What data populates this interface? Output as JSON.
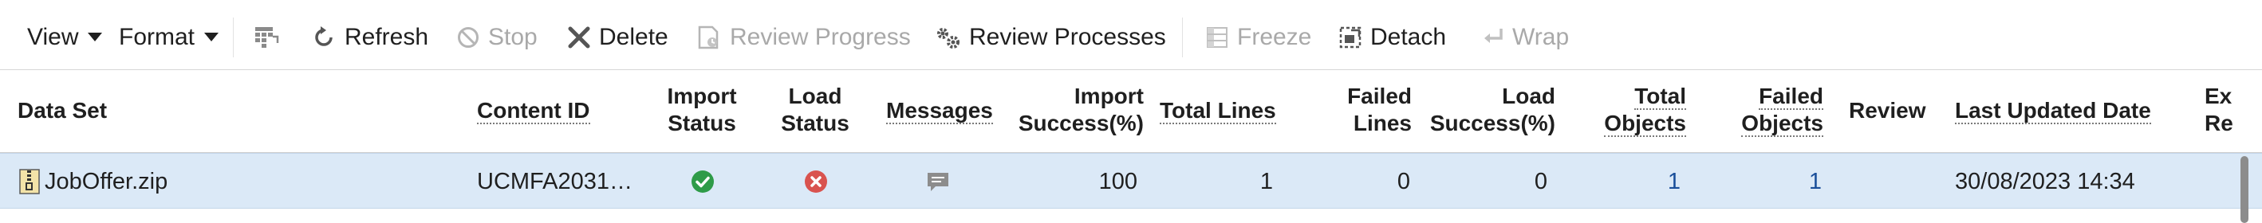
{
  "toolbar": {
    "view_label": "View",
    "format_label": "Format",
    "refresh_label": "Refresh",
    "stop_label": "Stop",
    "delete_label": "Delete",
    "review_progress_label": "Review Progress",
    "review_processes_label": "Review Processes",
    "freeze_label": "Freeze",
    "detach_label": "Detach",
    "wrap_label": "Wrap"
  },
  "table": {
    "headers": {
      "data_set": "Data Set",
      "content_id": "Content ID",
      "import_status_1": "Import",
      "import_status_2": "Status",
      "load_status_1": "Load",
      "load_status_2": "Status",
      "messages": "Messages",
      "import_success_1": "Import",
      "import_success_2": "Success(%)",
      "total_lines": "Total Lines",
      "failed_lines_1": "Failed",
      "failed_lines_2": "Lines",
      "load_success_1": "Load",
      "load_success_2": "Success(%)",
      "total_objects_1": "Total",
      "total_objects_2": "Objects",
      "failed_objects_1": "Failed",
      "failed_objects_2": "Objects",
      "review": "Review",
      "last_updated": "Last Updated Date",
      "extra_1": "Ex",
      "extra_2": "Re"
    },
    "rows": [
      {
        "data_set": "JobOffer.zip",
        "content_id": "UCMFA2031…",
        "import_status_icon": "success-check-icon",
        "load_status_icon": "error-x-icon",
        "messages_icon": "message-icon",
        "import_success": "100",
        "total_lines": "1",
        "failed_lines": "0",
        "load_success": "0",
        "total_objects": "1",
        "failed_objects": "1",
        "last_updated": "30/08/2023 14:34"
      }
    ]
  },
  "colors": {
    "success": "#2e9b48",
    "error": "#d9534f",
    "row_selected": "#dbe9f7",
    "link": "#1a4f9a",
    "disabled": "#a9a9a9"
  }
}
